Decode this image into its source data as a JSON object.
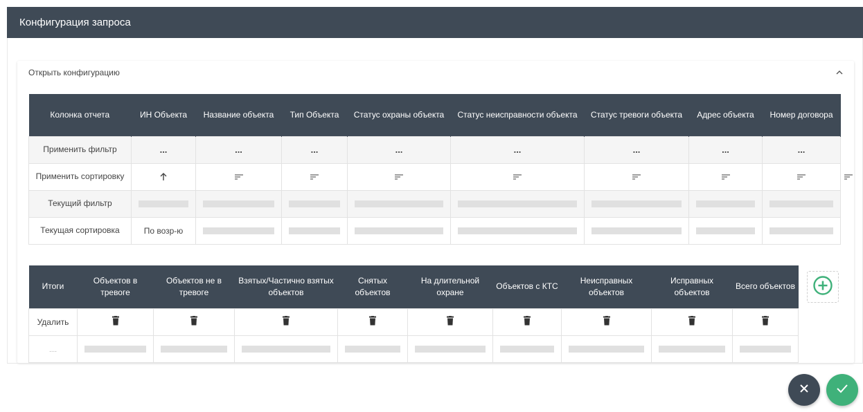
{
  "window": {
    "title": "Конфигурация запроса"
  },
  "config_panel": {
    "header": "Открыть конфигурацию"
  },
  "config_table": {
    "columns": [
      "Колонка отчета",
      "ИН Объекта",
      "Название объекта",
      "Тип Объекта",
      "Статус охраны объекта",
      "Статус неисправности объекта",
      "Статус тревоги объекта",
      "Адрес объекта",
      "Номер договора"
    ],
    "row_labels": [
      "Применить фильтр",
      "Применить сортировку",
      "Текущий фильтр",
      "Текущая сортировка"
    ],
    "filter_placeholder": "...",
    "current_sort_first": "По возр-ю"
  },
  "totals_table": {
    "columns": [
      "Итоги",
      "Объектов в тревоге",
      "Объектов не в тревоге",
      "Взятых/Частично взятых объектов",
      "Снятых объектов",
      "На длительной охране",
      "Объектов с КТС",
      "Неисправных объектов",
      "Исправных объектов",
      "Всего объектов"
    ],
    "delete_label": "Удалить",
    "value_row_label": "...."
  },
  "icons": {
    "collapse": "chevron-up-icon",
    "sort_asc": "arrow-up-icon",
    "sort": "sort-lines-icon",
    "delete": "trash-icon",
    "add": "plus-circle-icon",
    "cancel": "close-icon",
    "confirm": "check-icon"
  },
  "colors": {
    "header_bg": "#3f4a56",
    "accent_green": "#3fb17a",
    "placeholder_bar": "#e0e0e0"
  }
}
